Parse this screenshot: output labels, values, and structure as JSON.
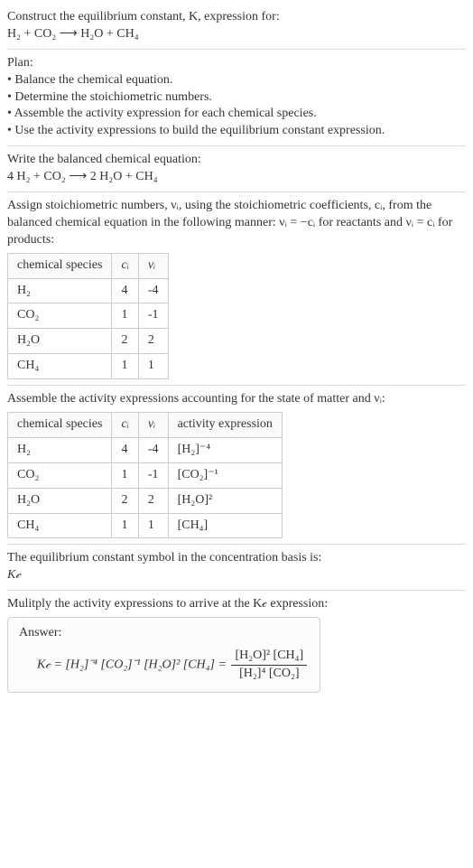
{
  "intro": {
    "line1": "Construct the equilibrium constant, K, expression for:",
    "eq_unbalanced": "H₂ + CO₂ ⟶ H₂O + CH₄"
  },
  "plan": {
    "heading": "Plan:",
    "items": [
      "• Balance the chemical equation.",
      "• Determine the stoichiometric numbers.",
      "• Assemble the activity expression for each chemical species.",
      "• Use the activity expressions to build the equilibrium constant expression."
    ]
  },
  "balanced": {
    "heading": "Write the balanced chemical equation:",
    "eq": "4 H₂ + CO₂ ⟶ 2 H₂O + CH₄"
  },
  "assign": {
    "text": "Assign stoichiometric numbers, νᵢ, using the stoichiometric coefficients, cᵢ, from the balanced chemical equation in the following manner: νᵢ = −cᵢ for reactants and νᵢ = cᵢ for products:",
    "headers": [
      "chemical species",
      "cᵢ",
      "νᵢ"
    ],
    "rows": [
      [
        "H₂",
        "4",
        "-4"
      ],
      [
        "CO₂",
        "1",
        "-1"
      ],
      [
        "H₂O",
        "2",
        "2"
      ],
      [
        "CH₄",
        "1",
        "1"
      ]
    ]
  },
  "activity": {
    "text": "Assemble the activity expressions accounting for the state of matter and νᵢ:",
    "headers": [
      "chemical species",
      "cᵢ",
      "νᵢ",
      "activity expression"
    ],
    "rows": [
      [
        "H₂",
        "4",
        "-4",
        "[H₂]⁻⁴"
      ],
      [
        "CO₂",
        "1",
        "-1",
        "[CO₂]⁻¹"
      ],
      [
        "H₂O",
        "2",
        "2",
        "[H₂O]²"
      ],
      [
        "CH₄",
        "1",
        "1",
        "[CH₄]"
      ]
    ]
  },
  "symbol": {
    "text": "The equilibrium constant symbol in the concentration basis is:",
    "kc": "K𝒸"
  },
  "multiply": {
    "text": "Mulitply the activity expressions to arrive at the K𝒸 expression:",
    "answer_label": "Answer:",
    "lhs": "K𝒸 = [H₂]⁻⁴ [CO₂]⁻¹ [H₂O]² [CH₄] =",
    "num": "[H₂O]² [CH₄]",
    "den": "[H₂]⁴ [CO₂]"
  },
  "chart_data": {
    "type": "table",
    "tables": [
      {
        "title": "Stoichiometric numbers",
        "columns": [
          "chemical species",
          "c_i",
          "ν_i"
        ],
        "rows": [
          [
            "H2",
            4,
            -4
          ],
          [
            "CO2",
            1,
            -1
          ],
          [
            "H2O",
            2,
            2
          ],
          [
            "CH4",
            1,
            1
          ]
        ]
      },
      {
        "title": "Activity expressions",
        "columns": [
          "chemical species",
          "c_i",
          "ν_i",
          "activity expression"
        ],
        "rows": [
          [
            "H2",
            4,
            -4,
            "[H2]^-4"
          ],
          [
            "CO2",
            1,
            -1,
            "[CO2]^-1"
          ],
          [
            "H2O",
            2,
            2,
            "[H2O]^2"
          ],
          [
            "CH4",
            1,
            1,
            "[CH4]"
          ]
        ]
      }
    ],
    "balanced_equation": "4 H2 + CO2 -> 2 H2O + CH4",
    "Kc_expression": "([H2O]^2 * [CH4]) / ([H2]^4 * [CO2])"
  }
}
